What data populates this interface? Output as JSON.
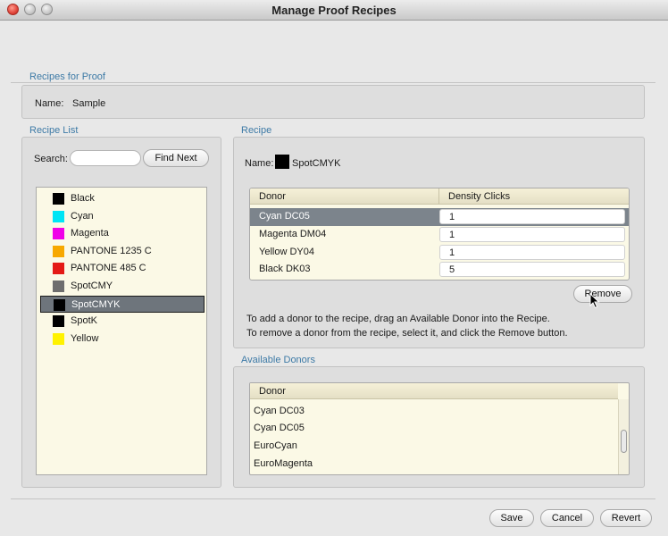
{
  "window": {
    "title": "Manage Proof Recipes"
  },
  "recipes_for_proof": {
    "heading": "Recipes for Proof",
    "name_label": "Name:",
    "name_value": "Sample"
  },
  "recipe_list": {
    "heading": "Recipe List",
    "search_label": "Search:",
    "search_value": "",
    "find_next_label": "Find Next",
    "items": [
      {
        "label": "Black",
        "color": "#000000"
      },
      {
        "label": "Cyan",
        "color": "#00e5f5"
      },
      {
        "label": "Magenta",
        "color": "#f000e8"
      },
      {
        "label": "PANTONE 1235 C",
        "color": "#f7a800"
      },
      {
        "label": "PANTONE 485 C",
        "color": "#e41a15"
      },
      {
        "label": "SpotCMY",
        "color": "#6e6e6e"
      },
      {
        "label": "SpotCMYK",
        "color": "#000000",
        "selected": true
      },
      {
        "label": "SpotK",
        "color": "#000000"
      },
      {
        "label": "Yellow",
        "color": "#fff200"
      }
    ]
  },
  "recipe": {
    "heading": "Recipe",
    "name_label": "Name:",
    "name_value": "SpotCMYK",
    "name_swatch_color": "#000000",
    "columns": [
      "Donor",
      "Density Clicks"
    ],
    "rows": [
      {
        "donor": "Cyan DC05",
        "clicks": "1",
        "selected": true
      },
      {
        "donor": "Magenta DM04",
        "clicks": "1"
      },
      {
        "donor": "Yellow DY04",
        "clicks": "1"
      },
      {
        "donor": "Black DK03",
        "clicks": "5"
      }
    ],
    "remove_label": "Remove",
    "hint_add": "To add a donor to the recipe, drag an Available Donor into the Recipe.",
    "hint_remove": "To remove a donor from the recipe, select it, and click the Remove button."
  },
  "available_donors": {
    "heading": "Available Donors",
    "column": "Donor",
    "items": [
      "Cyan DC03",
      "Cyan DC05",
      "EuroCyan",
      "EuroMagenta"
    ]
  },
  "footer": {
    "save_label": "Save",
    "cancel_label": "Cancel",
    "revert_label": "Revert"
  }
}
